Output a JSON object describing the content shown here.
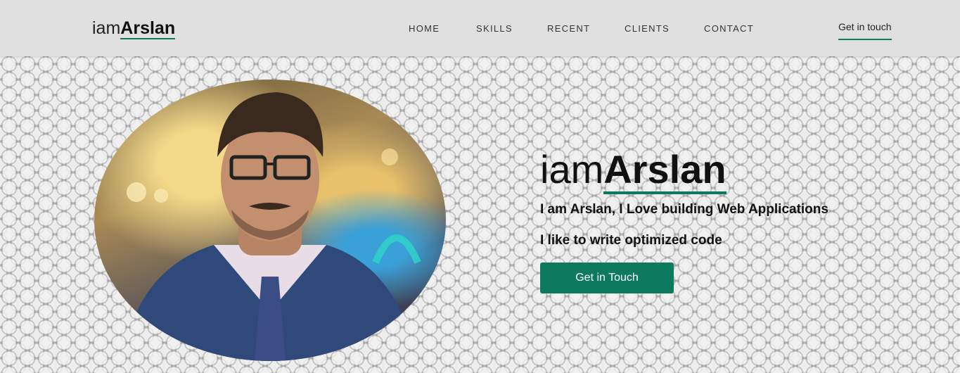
{
  "header": {
    "logo": {
      "prefix": "iam",
      "name": "Arslan"
    },
    "nav": [
      "HOME",
      "SKILLS",
      "RECENT",
      "CLIENTS",
      "CONTACT"
    ],
    "cta": "Get in touch"
  },
  "hero": {
    "title": {
      "prefix": "iam",
      "name": "Arslan"
    },
    "line1": "I am Arslan, I Love building Web Applications",
    "line2": "I like to write optimized code",
    "button": "Get in Touch"
  },
  "colors": {
    "accent": "#0d7a5f",
    "header_bg": "#e0e0e0"
  }
}
